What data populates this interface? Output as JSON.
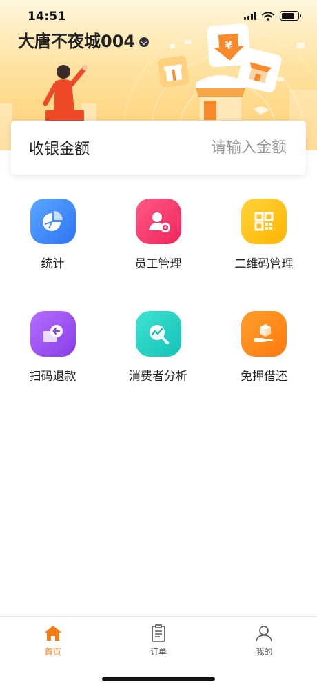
{
  "status_bar": {
    "time": "14:51"
  },
  "header": {
    "store_name": "大唐不夜城004"
  },
  "amount": {
    "label": "收银金额",
    "placeholder": "请输入金额"
  },
  "features": [
    {
      "label": "统计",
      "icon": "pie-chart-icon",
      "color": "#3d8dff"
    },
    {
      "label": "员工管理",
      "icon": "employee-gear-icon",
      "color": "#ff3c6e"
    },
    {
      "label": "二维码管理",
      "icon": "qr-code-icon",
      "color": "#ffc21a"
    },
    {
      "label": "扫码退款",
      "icon": "refund-icon",
      "color": "#9b53f0"
    },
    {
      "label": "消费者分析",
      "icon": "trend-search-icon",
      "color": "#1fd1c4"
    },
    {
      "label": "免押借还",
      "icon": "box-hand-icon",
      "color": "#ff8a12"
    }
  ],
  "tabbar": {
    "items": [
      {
        "label": "首页",
        "icon": "home-icon",
        "active": true
      },
      {
        "label": "订单",
        "icon": "clipboard-icon",
        "active": false
      },
      {
        "label": "我的",
        "icon": "person-icon",
        "active": false
      }
    ],
    "active_color": "#f47a16"
  },
  "banner_badge": "¥"
}
